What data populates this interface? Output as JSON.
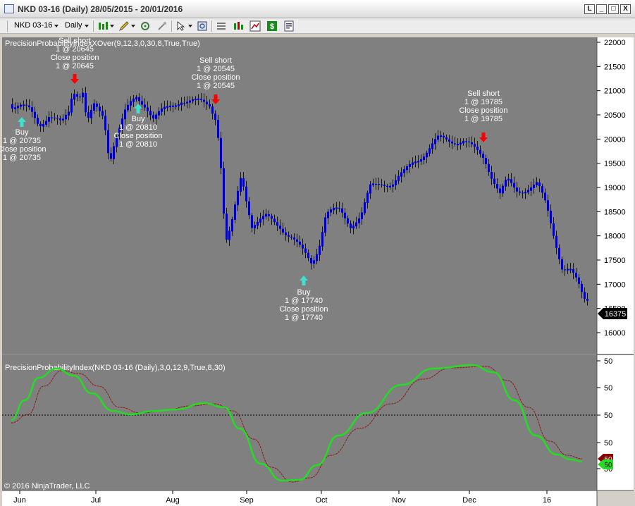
{
  "window": {
    "title": "NKD 03-16 (Daily)  28/05/2015 - 20/01/2016",
    "buttons": [
      "L",
      "_",
      "□",
      "X"
    ]
  },
  "toolbar": {
    "instrument": "NKD 03-16",
    "interval": "Daily"
  },
  "colors": {
    "chart_bg": "#808080",
    "bar": "#0000b8",
    "fast_line": "#22dd22",
    "slow_line": "#8b1a1a",
    "buy_arrow": "#40e0d0",
    "sell_arrow": "#ff0000"
  },
  "price_panel": {
    "indicator_label": "PrecisionProbabilityIndexXOver(9,12,3,0,30,8,True,True)",
    "last_price": "16375",
    "y_ticks": [
      "22000",
      "21500",
      "21000",
      "20500",
      "20000",
      "19500",
      "19000",
      "18500",
      "18000",
      "17500",
      "17000",
      "16500",
      "16000"
    ],
    "trades": [
      {
        "type": "buy",
        "lines": [
          "Buy",
          "1 @ 20735",
          "Close position",
          "1 @ 20735"
        ]
      },
      {
        "type": "sell",
        "lines": [
          "Sell short",
          "1 @ 20645",
          "Close position",
          "1 @ 20645"
        ]
      },
      {
        "type": "buy",
        "lines": [
          "Buy",
          "1 @ 20810",
          "Close position",
          "1 @ 20810"
        ]
      },
      {
        "type": "sell",
        "lines": [
          "Sell short",
          "1 @ 20545",
          "Close position",
          "1 @ 20545"
        ]
      },
      {
        "type": "buy",
        "lines": [
          "Buy",
          "1 @ 17740",
          "Close position",
          "1 @ 17740"
        ]
      },
      {
        "type": "sell",
        "lines": [
          "Sell short",
          "1 @ 19785",
          "Close position",
          "1 @ 19785"
        ]
      }
    ]
  },
  "indicator_panel": {
    "label": "PrecisionProbabilityIndex(NKD 03-16 (Daily),3,0,12,9,True,8,30)",
    "y_ticks": [
      "50",
      "50",
      "50",
      "50",
      "50"
    ],
    "badge_red": "50",
    "badge_green": "50",
    "copyright": "© 2016 NinjaTrader, LLC"
  },
  "x_axis": {
    "labels": [
      "Jun",
      "Jul",
      "Aug",
      "Sep",
      "Oct",
      "Nov",
      "Dec",
      "16"
    ]
  }
}
